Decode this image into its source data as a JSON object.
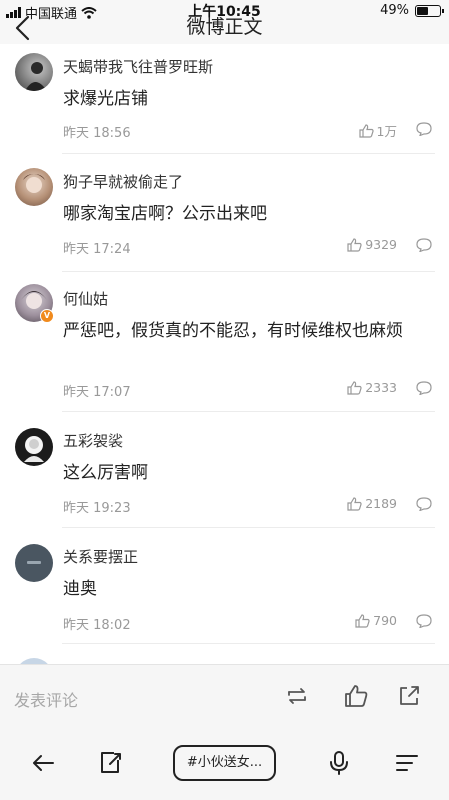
{
  "status_bar": {
    "carrier": "中国联通",
    "time": "上午10:45",
    "battery": "49%",
    "battery_level": 0.49
  },
  "header": {
    "title": "微博正文"
  },
  "comments": [
    {
      "user": "天蝎带我飞往普罗旺斯",
      "text": "求爆光店铺",
      "time": "昨天 18:56",
      "likes": "1万"
    },
    {
      "user": "狗子早就被偷走了",
      "text": "哪家淘宝店啊？公示出来吧",
      "time": "昨天 17:24",
      "likes": "9329"
    },
    {
      "user": "何仙姑",
      "text": "严惩吧，假货真的不能忍，有时候维权也麻烦",
      "time": "昨天 17:07",
      "likes": "2333",
      "verified_badge": "V"
    },
    {
      "user": "五彩袈裟",
      "text": "这么厉害啊",
      "time": "昨天 19:23",
      "likes": "2189"
    },
    {
      "user": "关系要摆正",
      "text": "迪奥",
      "time": "昨天 18:02",
      "likes": "790"
    }
  ],
  "comment_bar": {
    "placeholder": "发表评论"
  },
  "toolbar": {
    "tag": "#小伙送女..."
  },
  "colors": {
    "background": "#ffffff",
    "bar_background": "#f6f6f6",
    "muted_text": "#999999",
    "verified_badge": "#f08a1d"
  },
  "icons": [
    "back-icon",
    "thumbs-up-icon",
    "comment-icon",
    "repost-icon",
    "share-icon",
    "browser-back-icon",
    "tabs-icon",
    "microphone-icon",
    "menu-icon"
  ]
}
